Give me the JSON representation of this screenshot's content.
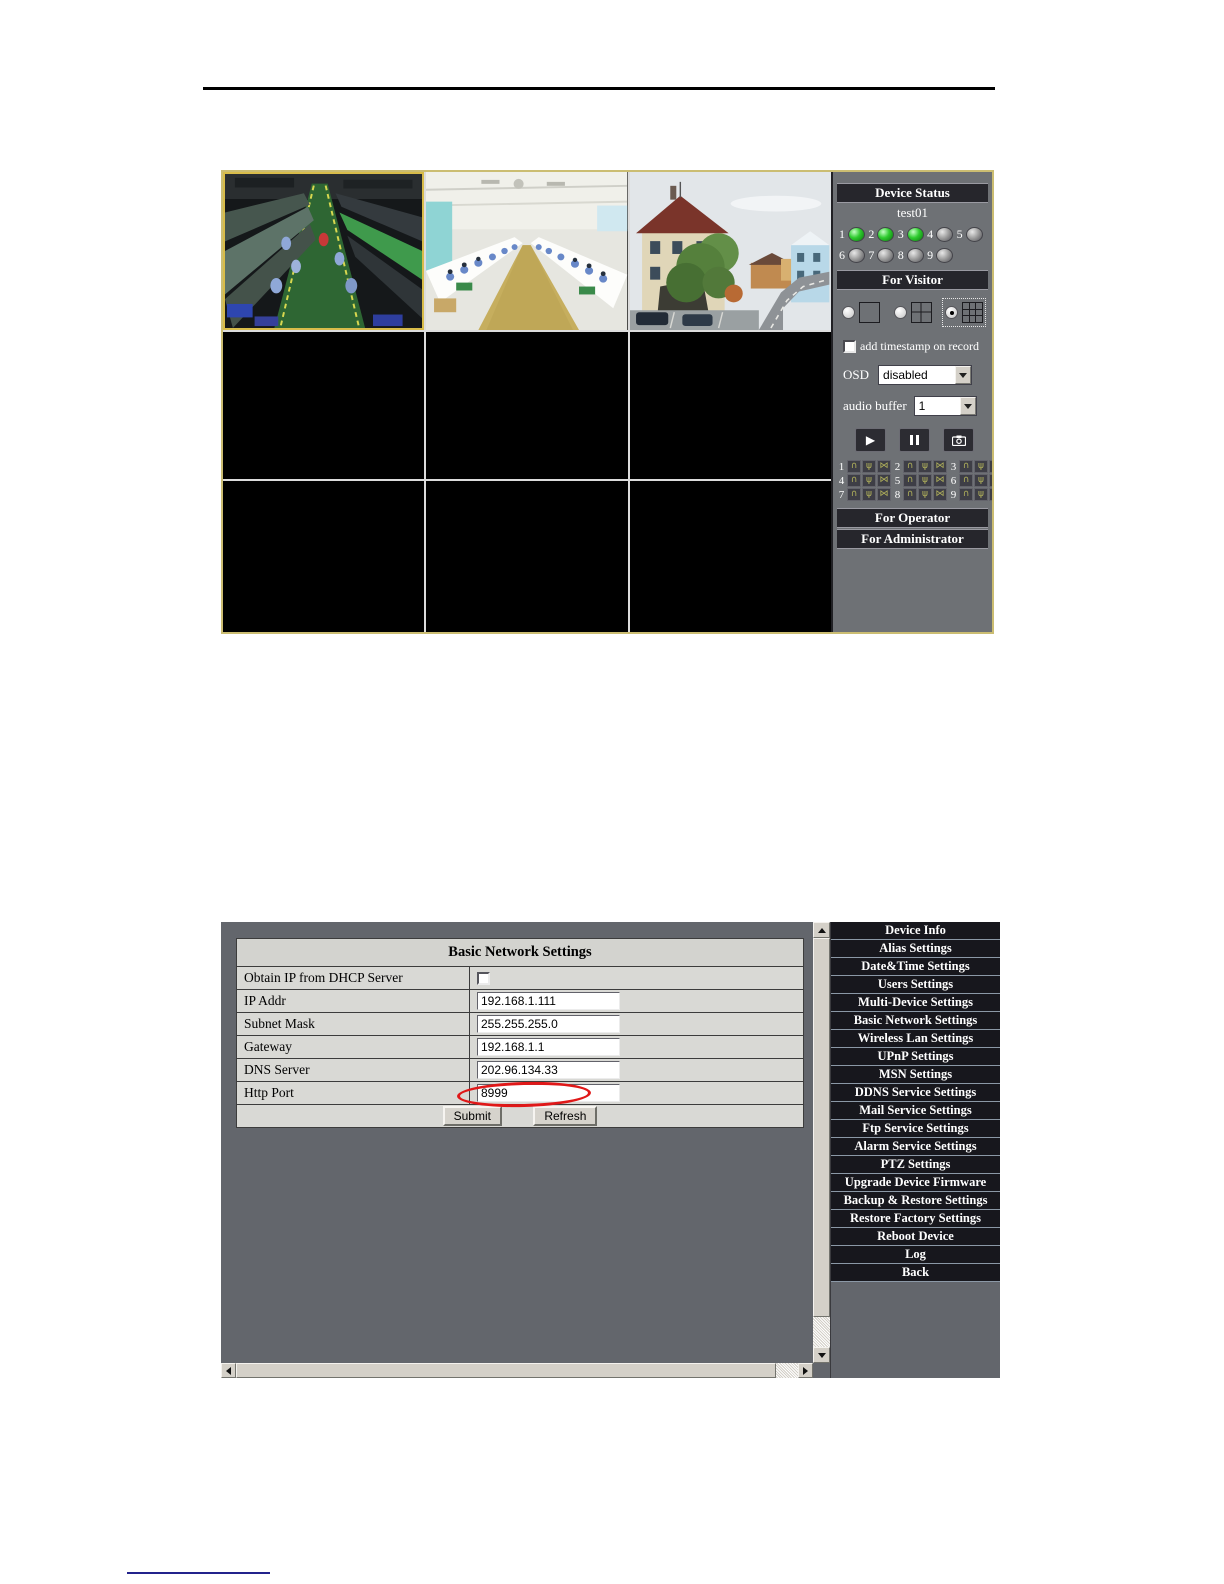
{
  "colors": {
    "led_on": "#2ecb2e",
    "led_off": "#9a9a9a",
    "annotation_red": "#e01818",
    "panel_gray": "#6e7175",
    "menu_item_bg": "#17171d",
    "selected_camera_border": "#d8bc4a"
  },
  "icons": {
    "play": "▶",
    "headphone": "∩",
    "mic": "ψ",
    "record": "⋈"
  },
  "viewer": {
    "device_status": {
      "title": "Device Status",
      "device_name": "test01",
      "channels": [
        {
          "n": 1,
          "on": true
        },
        {
          "n": 2,
          "on": true
        },
        {
          "n": 3,
          "on": true
        },
        {
          "n": 4,
          "on": false
        },
        {
          "n": 5,
          "on": false
        },
        {
          "n": 6,
          "on": false
        },
        {
          "n": 7,
          "on": false
        },
        {
          "n": 8,
          "on": false
        },
        {
          "n": 9,
          "on": false
        }
      ]
    },
    "for_visitor": {
      "label": "For Visitor",
      "view_modes": [
        {
          "name": "single-view",
          "selected": false
        },
        {
          "name": "quad-view",
          "selected": false
        },
        {
          "name": "nine-view",
          "selected": true
        }
      ],
      "timestamp_checkbox_label": "add timestamp on record",
      "osd_label": "OSD",
      "osd_value": "disabled",
      "audio_buffer_label": "audio buffer",
      "audio_buffer_value": "1",
      "channel_controls": {
        "channels": [
          1,
          2,
          3,
          4,
          5,
          6,
          7,
          8,
          9
        ]
      }
    },
    "for_operator_label": "For Operator",
    "for_administrator_label": "For Administrator"
  },
  "settings": {
    "form": {
      "title": "Basic Network Settings",
      "rows": [
        {
          "label": "Obtain IP from DHCP Server",
          "type": "checkbox",
          "checked": false
        },
        {
          "label": "IP Addr",
          "value": "192.168.1.111"
        },
        {
          "label": "Subnet Mask",
          "value": "255.255.255.0"
        },
        {
          "label": "Gateway",
          "value": "192.168.1.1"
        },
        {
          "label": "DNS Server",
          "value": "202.96.134.33"
        },
        {
          "label": "Http Port",
          "value": "8999",
          "circled": true
        }
      ],
      "submit_label": "Submit",
      "refresh_label": "Refresh"
    },
    "menu": [
      "Device Info",
      "Alias Settings",
      "Date&Time Settings",
      "Users Settings",
      "Multi-Device Settings",
      "Basic Network Settings",
      "Wireless Lan Settings",
      "UPnP Settings",
      "MSN Settings",
      "DDNS Service Settings",
      "Mail Service Settings",
      "Ftp Service Settings",
      "Alarm Service Settings",
      "PTZ Settings",
      "Upgrade Device Firmware",
      "Backup & Restore Settings",
      "Restore Factory Settings",
      "Reboot Device",
      "Log",
      "Back"
    ]
  }
}
